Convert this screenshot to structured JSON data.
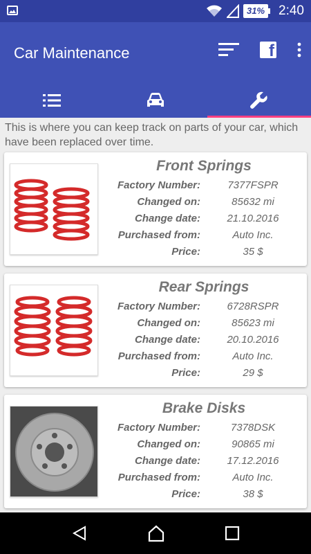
{
  "status": {
    "battery": "31%",
    "time": "2:40"
  },
  "app": {
    "title": "Car Maintenance"
  },
  "intro": "This is where you can keep track on parts of your car, which have been replaced over time.",
  "labels": {
    "factory": "Factory Number:",
    "changed_on": "Changed on:",
    "change_date": "Change date:",
    "purchased": "Purchased from:",
    "price": "Price:"
  },
  "parts": [
    {
      "name": "Front Springs",
      "factory": "7377FSPR",
      "changed_on": "85632 mi",
      "change_date": "21.10.2016",
      "purchased": "Auto Inc.",
      "price": "35 $"
    },
    {
      "name": "Rear Springs",
      "factory": "6728RSPR",
      "changed_on": "85623 mi",
      "change_date": "20.10.2016",
      "purchased": "Auto Inc.",
      "price": "29 $"
    },
    {
      "name": "Brake Disks",
      "factory": "7378DSK",
      "changed_on": "90865 mi",
      "change_date": "17.12.2016",
      "purchased": "Auto Inc.",
      "price": "38 $"
    }
  ],
  "colors": {
    "primary": "#3f51b5",
    "primary_dark": "#303f9f",
    "accent": "#ff4081"
  },
  "icons": {
    "status_left": "image-notification-icon",
    "app_actions": [
      "sort-icon",
      "facebook-icon",
      "more-vert-icon"
    ],
    "tabs": [
      "list-icon",
      "car-icon",
      "wrench-icon"
    ],
    "nav": [
      "back-icon",
      "home-icon",
      "recents-icon"
    ]
  }
}
